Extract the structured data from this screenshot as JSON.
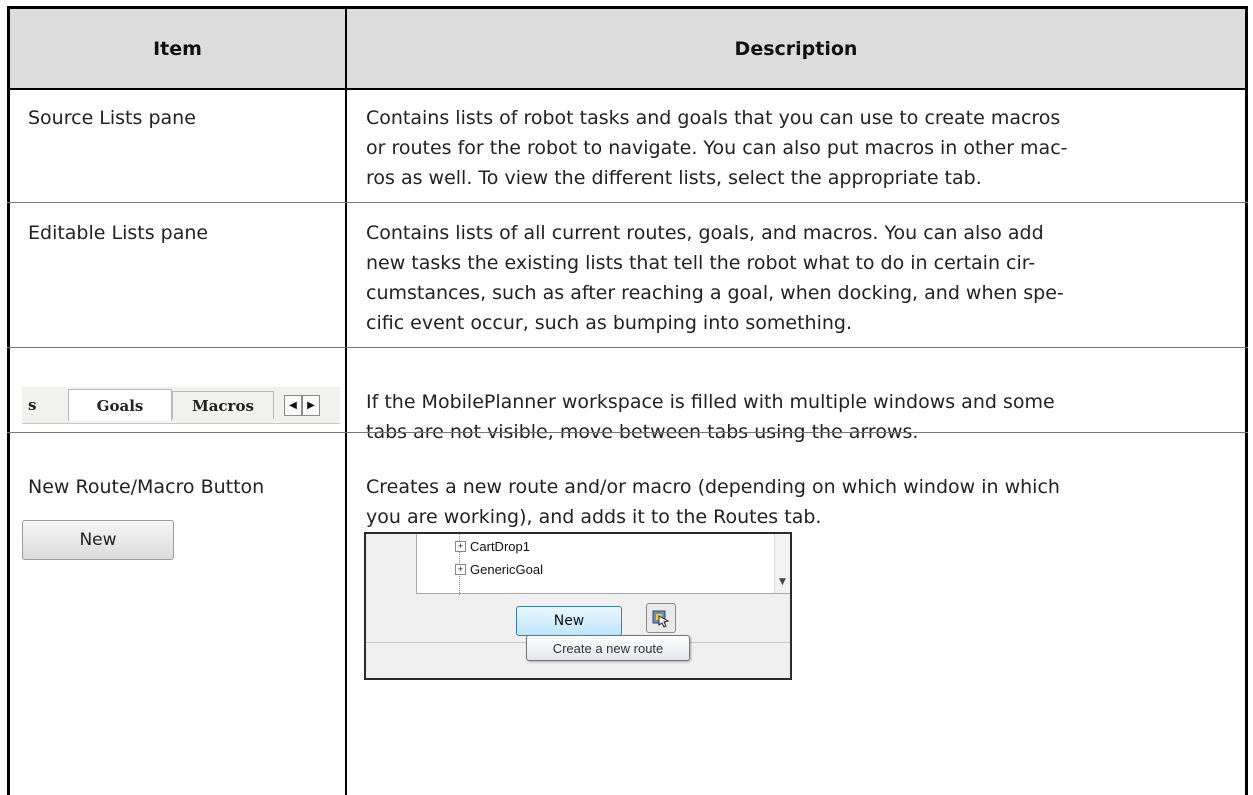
{
  "table": {
    "headers": {
      "item": "Item",
      "description": "Description"
    },
    "rows": [
      {
        "item": "Source Lists pane",
        "description": [
          "Contains lists of robot tasks and goals that you can use to create macros",
          "or routes for the robot to navigate. You can also put macros in other mac-",
          "ros as well. To view the different lists, select the appropriate tab."
        ]
      },
      {
        "item": "Editable Lists pane",
        "description": [
          "Contains lists of all current routes, goals, and macros. You can also add",
          "new tasks the existing lists that tell the robot what to do in certain cir-",
          "cumstances, such as after reaching a goal, when docking, and when spe-",
          "cific event occur, such as bumping into something."
        ]
      },
      {
        "item_image": {
          "tabs": [
            "s",
            "Goals",
            "Macros"
          ],
          "arrows": [
            "◀",
            "▶"
          ]
        },
        "description": [
          "If the MobilePlanner workspace is filled with multiple windows and some",
          "tabs are not visible, move between tabs using the arrows."
        ]
      },
      {
        "item": "New Route/Macro Button",
        "item_button_label": "New",
        "description": [
          "Creates a new route and/or macro (depending on which window in which",
          "you are working), and adds it to the Routes tab."
        ],
        "screenshot": {
          "tree_items": [
            "CartDrop1",
            "GenericGoal"
          ],
          "button_label": "New",
          "tooltip": "Create a new route"
        }
      }
    ]
  }
}
